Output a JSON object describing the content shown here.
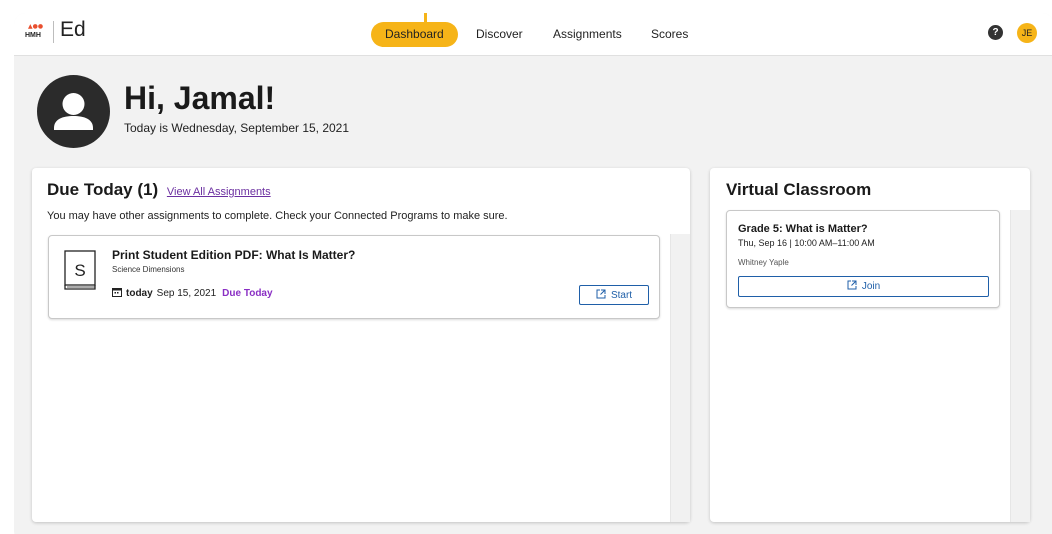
{
  "brand": {
    "logo_text": "HMH",
    "name": "Ed"
  },
  "nav": {
    "tabs": [
      {
        "label": "Dashboard",
        "active": true
      },
      {
        "label": "Discover",
        "active": false
      },
      {
        "label": "Assignments",
        "active": false
      },
      {
        "label": "Scores",
        "active": false
      }
    ],
    "help_icon": "?",
    "user_initials": "JE"
  },
  "header": {
    "greeting": "Hi, Jamal!",
    "date_line": "Today is Wednesday, September 15, 2021"
  },
  "due_today": {
    "title": "Due Today (1)",
    "view_all_label": "View All Assignments",
    "message": "You may have other assignments to complete. Check your Connected Programs to make sure.",
    "assignment": {
      "book_letter": "S",
      "title": "Print Student Edition PDF: What Is Matter?",
      "program": "Science Dimensions",
      "when_label": "today",
      "date": "Sep 15, 2021",
      "status": "Due Today",
      "start_label": "Start"
    }
  },
  "virtual_classroom": {
    "title": "Virtual Classroom",
    "session": {
      "title": "Grade 5: What is Matter?",
      "time": "Thu, Sep 16 | 10:00 AM–11:00 AM",
      "teacher": "Whitney Yaple",
      "join_label": "Join"
    }
  },
  "colors": {
    "accent": "#f6b418",
    "link": "#6b2fa0",
    "button_blue": "#1f5fa8",
    "status_purple": "#8a2fc4"
  }
}
